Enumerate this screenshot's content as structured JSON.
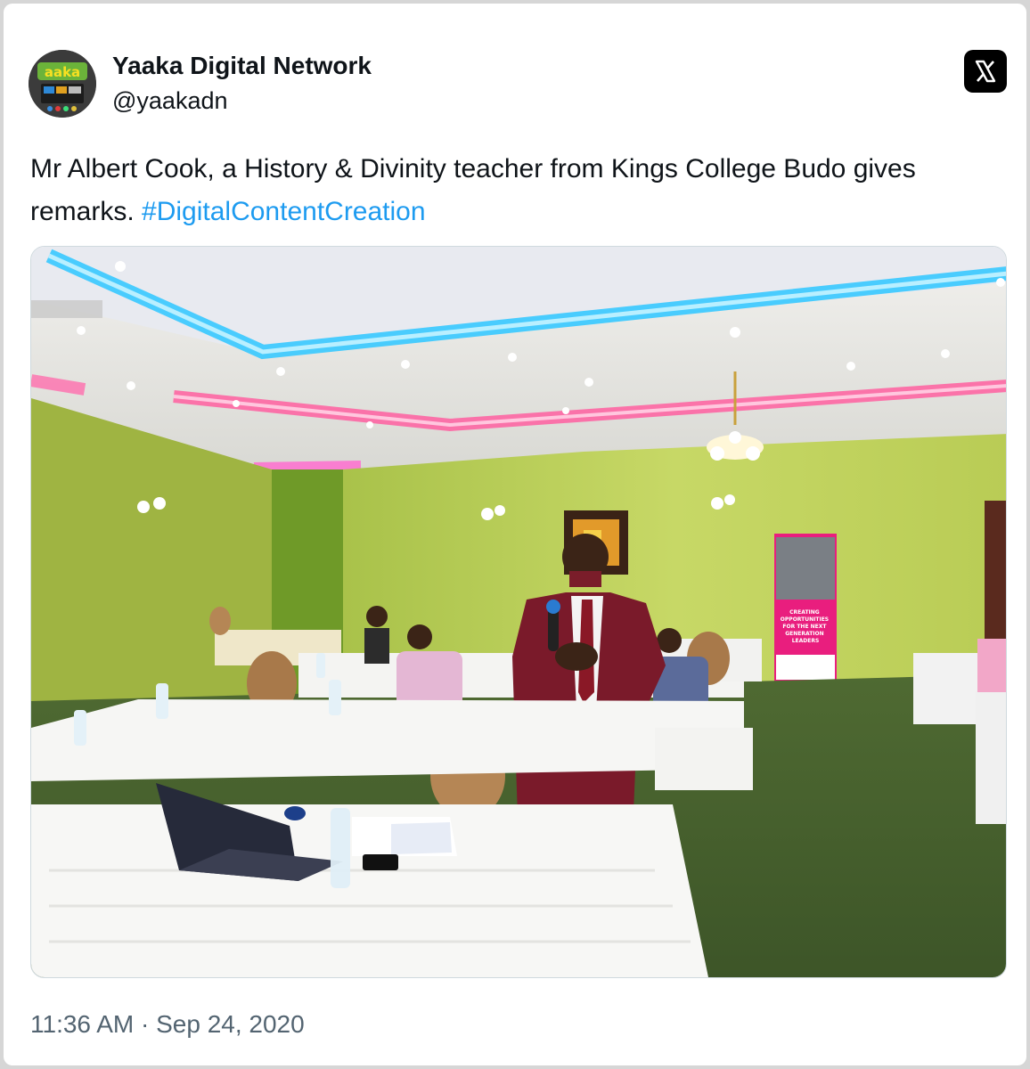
{
  "author": {
    "display_name": "Yaaka Digital Network",
    "handle": "@yaakadn",
    "avatar_logo_text": "Yaaka"
  },
  "tweet": {
    "text": "Mr Albert Cook, a History & Divinity teacher from Kings College Budo gives remarks.",
    "hashtag": "#DigitalContentCreation",
    "timestamp": "11:36 AM · Sep 24, 2020"
  },
  "photo": {
    "banner_text": "CREATING OPPORTUNITIES FOR THE NEXT GENERATION LEADERS"
  },
  "icons": {
    "platform_logo": "x-logo-icon"
  },
  "colors": {
    "hashtag": "#1d9bf0",
    "text": "#0f1419",
    "muted": "#536471"
  }
}
